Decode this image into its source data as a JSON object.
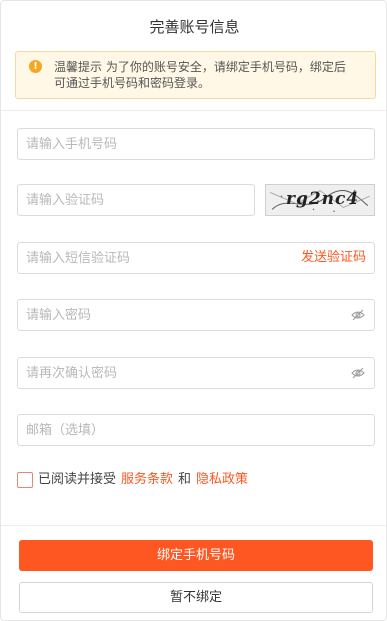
{
  "title": "完善账号信息",
  "tip": {
    "icon": "warning-icon",
    "text": "温馨提示 为了你的账号安全，请绑定手机号码，绑定后可通过手机号码和密码登录。"
  },
  "form": {
    "phone_placeholder": "请输入手机号码",
    "captcha_placeholder": "请输入验证码",
    "captcha_text": "rg2nc4",
    "sms_placeholder": "请输入短信验证码",
    "send_code_label": "发送验证码",
    "password_placeholder": "请输入密码",
    "confirm_password_placeholder": "请再次确认密码",
    "email_placeholder": "邮箱（选填）"
  },
  "agreement": {
    "prefix": "已阅读并接受",
    "terms_label": "服务条款",
    "conjunction": "和",
    "privacy_label": "隐私政策"
  },
  "actions": {
    "bind_label": "绑定手机号码",
    "skip_label": "暂不绑定"
  },
  "colors": {
    "accent": "#ff5722",
    "tip_background": "#fff8e6",
    "tip_icon": "#f5a623"
  }
}
